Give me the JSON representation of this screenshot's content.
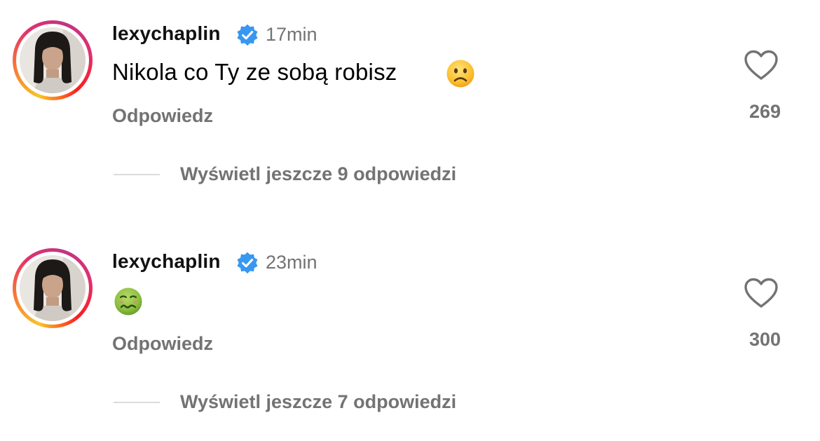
{
  "comments": [
    {
      "username": "lexychaplin",
      "verified": true,
      "timestamp": "17min",
      "text": "Nikola co Ty ze sobą robisz",
      "emoji": "slightly-frowning-face-icon",
      "reply_label": "Odpowiedz",
      "likes": "269",
      "view_replies_label": "Wyświetl jeszcze 9 odpowiedzi"
    },
    {
      "username": "lexychaplin",
      "verified": true,
      "timestamp": "23min",
      "text": "",
      "emoji": "nauseated-face-icon",
      "reply_label": "Odpowiedz",
      "likes": "300",
      "view_replies_label": "Wyświetl jeszcze 7 odpowiedzi"
    }
  ],
  "colors": {
    "verified_badge": "#3897f0",
    "secondary_text": "#737373",
    "divider": "#dbdbdb"
  }
}
